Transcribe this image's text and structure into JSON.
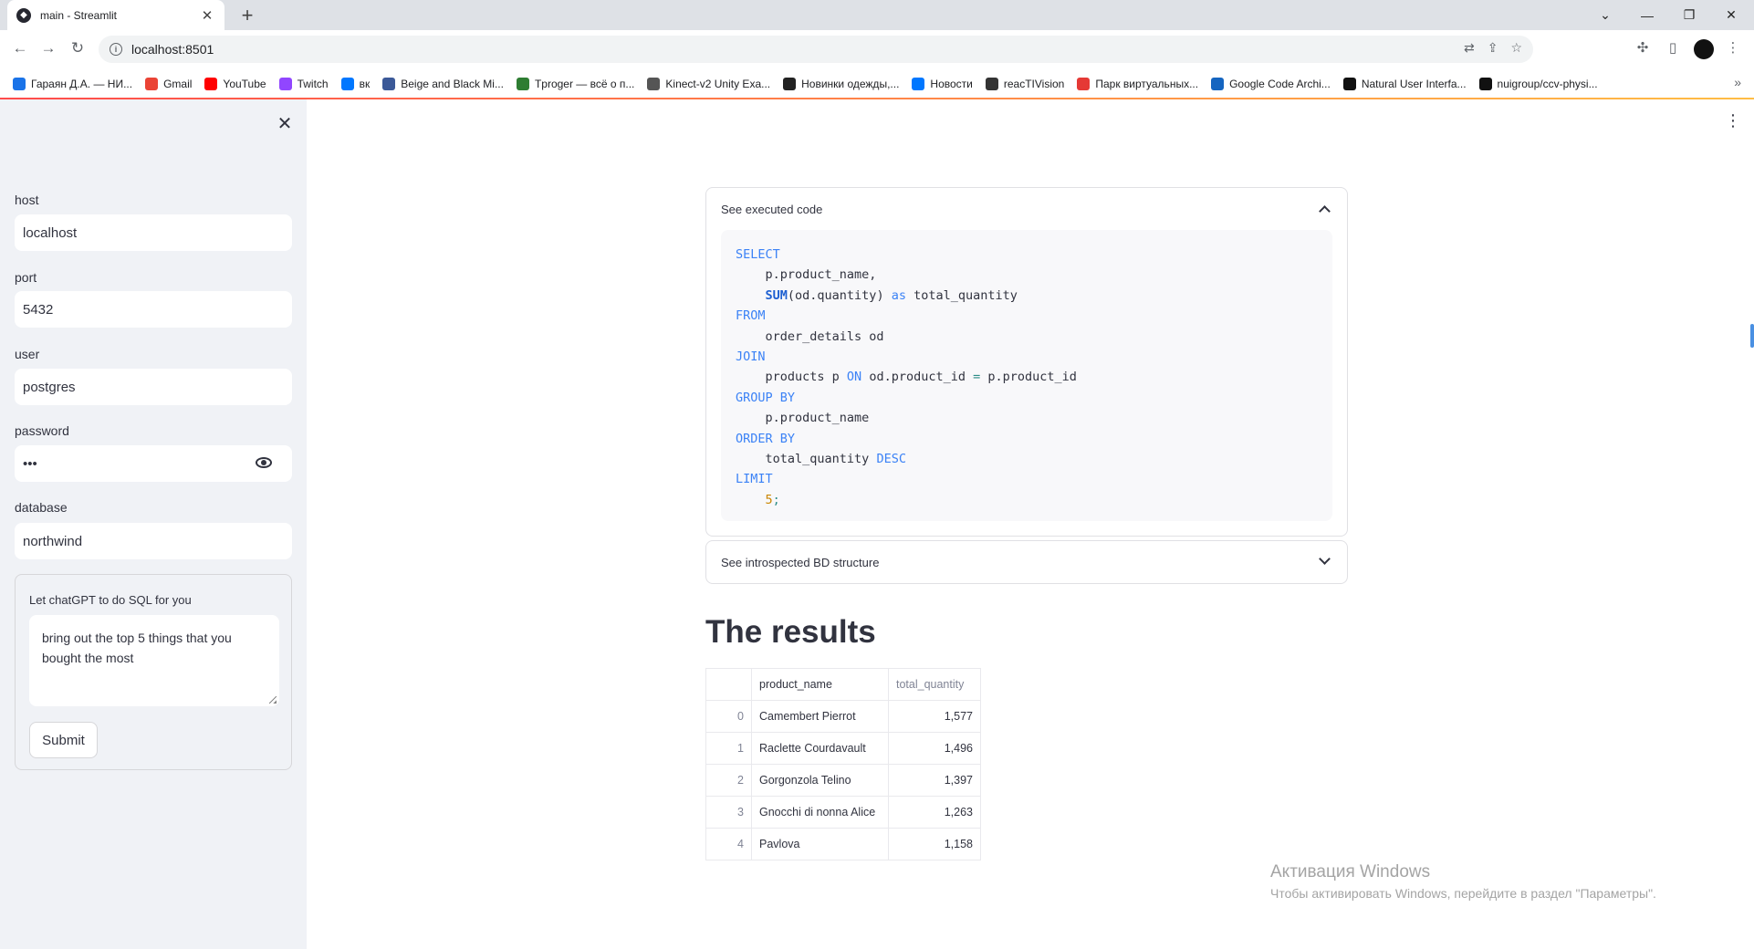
{
  "browser": {
    "tab_title": "main - Streamlit",
    "url": "localhost:8501",
    "bookmarks": [
      {
        "label": "Гараян Д.А. — НИ...",
        "color": "#1a73e8"
      },
      {
        "label": "Gmail",
        "color": "#ea4335"
      },
      {
        "label": "YouTube",
        "color": "#ff0000"
      },
      {
        "label": "Twitch",
        "color": "#9146ff"
      },
      {
        "label": "вк",
        "color": "#0077ff"
      },
      {
        "label": "Beige and Black Mi...",
        "color": "#3b5998"
      },
      {
        "label": "Tproger — всё о п...",
        "color": "#2e7d32"
      },
      {
        "label": "Kinect-v2 Unity Exa...",
        "color": "#555555"
      },
      {
        "label": "Новинки одежды,...",
        "color": "#222222"
      },
      {
        "label": "Новости",
        "color": "#0077ff"
      },
      {
        "label": "reacTIVision",
        "color": "#333333"
      },
      {
        "label": "Парк виртуальных...",
        "color": "#e53935"
      },
      {
        "label": "Google Code Archi...",
        "color": "#1565c0"
      },
      {
        "label": "Natural User Interfa...",
        "color": "#111111"
      },
      {
        "label": "nuigroup/ccv-physi...",
        "color": "#111111"
      }
    ]
  },
  "sidebar": {
    "host_label": "host",
    "host_value": "localhost",
    "port_label": "port",
    "port_value": "5432",
    "user_label": "user",
    "user_value": "postgres",
    "password_label": "password",
    "password_value": "•••",
    "database_label": "database",
    "database_value": "northwind",
    "form": {
      "prompt_label": "Let chatGPT to do SQL for you",
      "prompt_value": "bring out the top 5 things that you bought the most",
      "submit_label": "Submit"
    }
  },
  "main": {
    "executed_code_label": "See executed code",
    "introspected_label": "See introspected BD structure",
    "results_title": "The results",
    "table": {
      "columns": [
        "",
        "product_name",
        "total_quantity"
      ],
      "rows": [
        {
          "index": "0",
          "product_name": "Camembert Pierrot",
          "total_quantity": "1,577"
        },
        {
          "index": "1",
          "product_name": "Raclette Courdavault",
          "total_quantity": "1,496"
        },
        {
          "index": "2",
          "product_name": "Gorgonzola Telino",
          "total_quantity": "1,397"
        },
        {
          "index": "3",
          "product_name": "Gnocchi di nonna Alice",
          "total_quantity": "1,263"
        },
        {
          "index": "4",
          "product_name": "Pavlova",
          "total_quantity": "1,158"
        }
      ]
    }
  },
  "code": {
    "l1": "SELECT",
    "l2a": "    p.product_name,",
    "l3_fn": "SUM",
    "l3_mid": "(od.quantity) ",
    "l3_as": "as",
    "l3_end": " total_quantity",
    "l4": "FROM",
    "l5": "    order_details od",
    "l6": "JOIN",
    "l7a": "    products p ",
    "l7_on": "ON",
    "l7b": " od.product_id ",
    "l7_eq": "=",
    "l7c": " p.product_id",
    "l8": "GROUP BY",
    "l9": "    p.product_name",
    "l10": "ORDER BY",
    "l11a": "    total_quantity ",
    "l11_desc": "DESC",
    "l12": "LIMIT",
    "l13": "5",
    "l13_semi": ";"
  },
  "watermark": {
    "line1": "Активация Windows",
    "line2": "Чтобы активировать Windows, перейдите в раздел \"Параметры\"."
  },
  "colors": {
    "accent_gradient_start": "#ff4b4b",
    "accent_gradient_end": "#ffbd45",
    "sidebar_bg": "#f0f2f6",
    "keyword": "#3b82f6"
  }
}
